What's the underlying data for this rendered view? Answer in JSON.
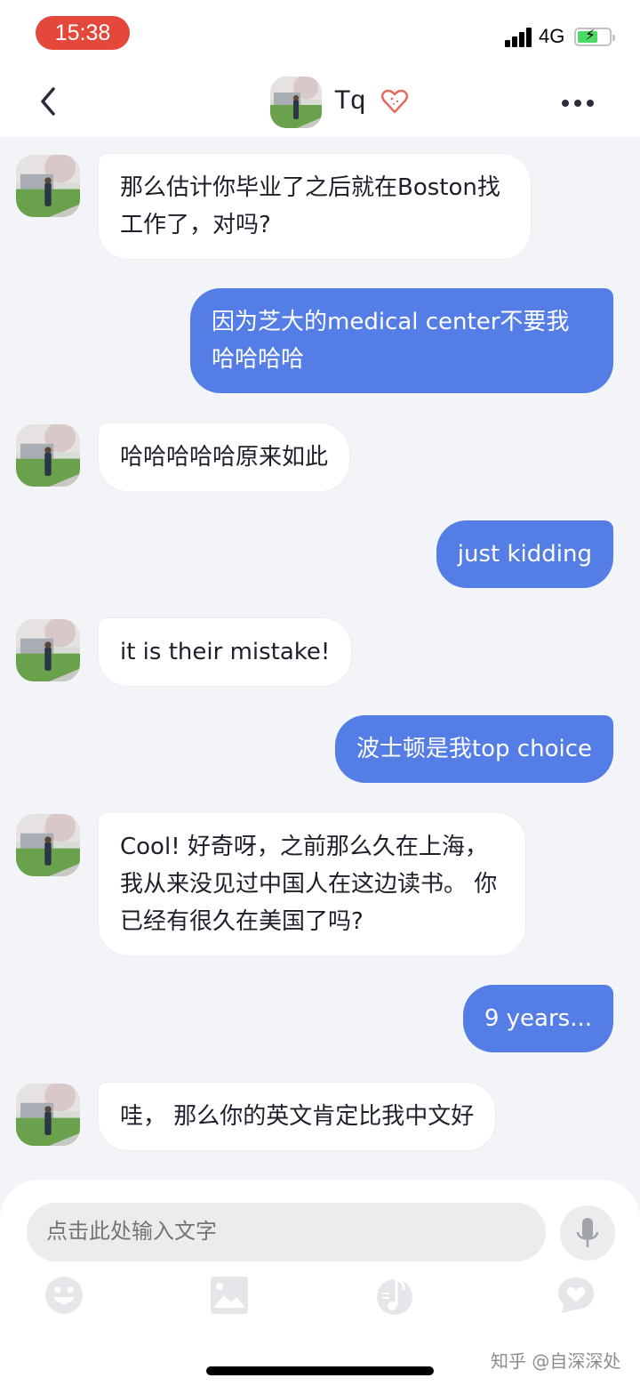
{
  "status_bar": {
    "time": "15:38",
    "network": "4G",
    "battery_charging": true
  },
  "header": {
    "title": "Tq",
    "back_icon": "chevron-left-icon",
    "heart_icon": "heart-icon",
    "more_icon": "more-dots-icon"
  },
  "messages": [
    {
      "sender": "contact",
      "text": "那么估计你毕业了之后就在Boston找工作了，对吗?"
    },
    {
      "sender": "me",
      "text": "因为芝大的medical center不要我哈哈哈哈"
    },
    {
      "sender": "contact",
      "text": "哈哈哈哈哈原来如此"
    },
    {
      "sender": "me",
      "text": "just kidding"
    },
    {
      "sender": "contact",
      "text": "it is their mistake!"
    },
    {
      "sender": "me",
      "text": "波士顿是我top choice"
    },
    {
      "sender": "contact",
      "text": "Cool! 好奇呀，之前那么久在上海，我从来没见过中国人在这边读书。 你已经有很久在美国了吗?"
    },
    {
      "sender": "me",
      "text": "9 years..."
    },
    {
      "sender": "contact",
      "text": "哇， 那么你的英文肯定比我中文好"
    }
  ],
  "composer": {
    "placeholder": "点击此处输入文字",
    "tools": [
      "emoji-icon",
      "image-icon",
      "music-icon",
      "heart-bubble-icon"
    ],
    "mic_icon": "microphone-icon"
  },
  "watermark": "知乎 @自深深处",
  "colors": {
    "outgoing_bubble": "#547de6",
    "time_pill": "#e3483a",
    "background": "#f3f4f8"
  }
}
